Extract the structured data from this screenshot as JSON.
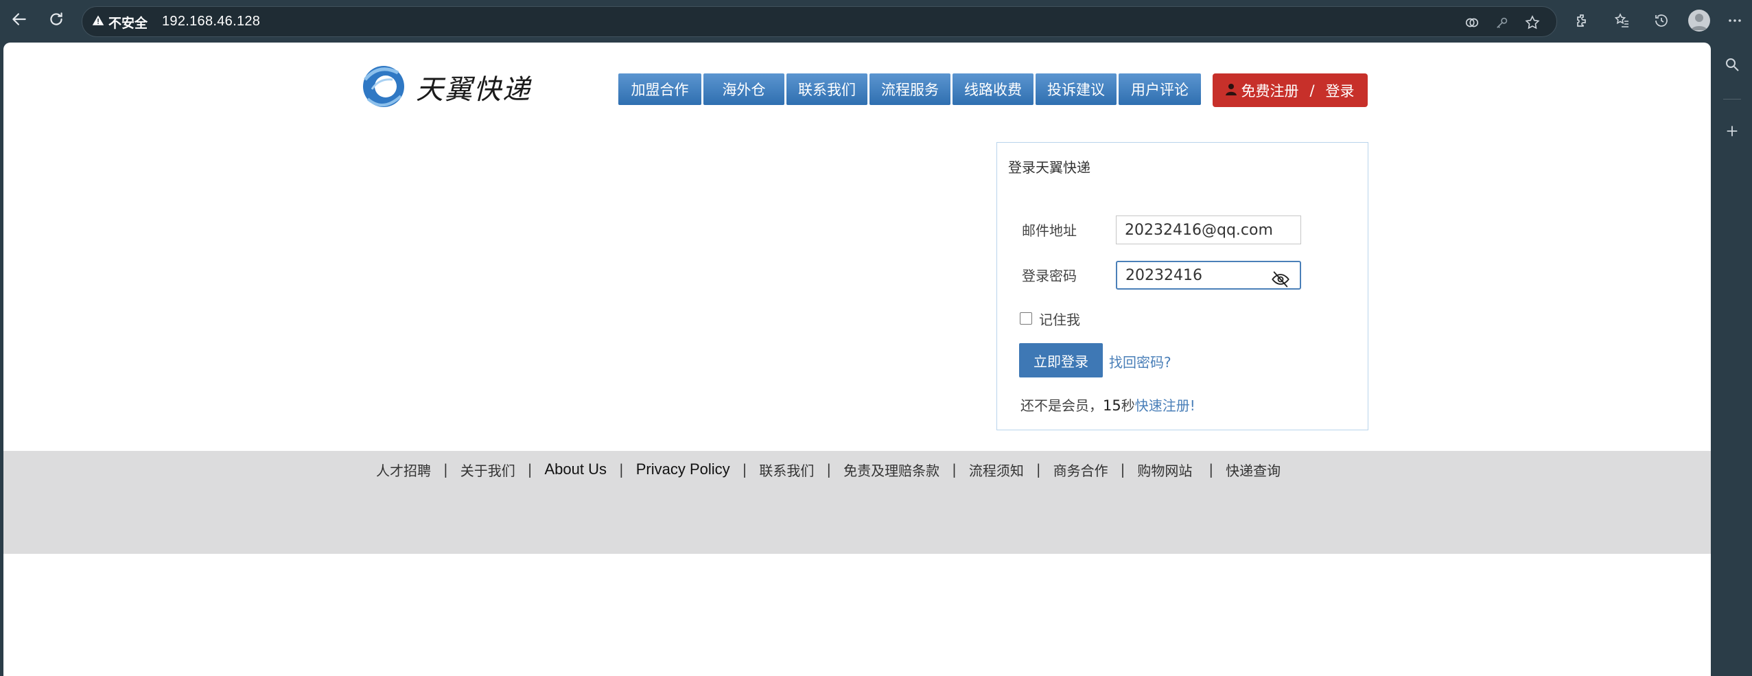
{
  "browser": {
    "security_label": "不安全",
    "url": "192.168.46.128"
  },
  "site": {
    "logo_text": "天翼快递",
    "nav": [
      "加盟合作",
      "海外仓",
      "联系我们",
      "流程服务",
      "线路收费",
      "投诉建议",
      "用户评论"
    ],
    "register_label": "免费注册",
    "separator": "/",
    "login_label": "登录"
  },
  "login": {
    "title": "登录天翼快递",
    "email_label": "邮件地址",
    "email_value": "20232416@qq.com",
    "password_label": "登录密码",
    "password_value": "20232416",
    "remember_label": "记住我",
    "submit_label": "立即登录",
    "forgot_label": "找回密码?",
    "member_prefix": "还不是会员，",
    "member_number": "15",
    "member_unit": "秒",
    "member_link": "快速注册",
    "member_suffix": "!"
  },
  "footer": {
    "links": [
      "人才招聘",
      "关于我们",
      "About Us",
      "Privacy Policy",
      "联系我们",
      "免责及理赔条款",
      "流程须知",
      "商务合作",
      "购物网站",
      "快递查询"
    ],
    "separator": "|"
  },
  "icons": {
    "back": "arrow-left-icon",
    "reload": "reload-icon",
    "warning": "warning-icon",
    "eye_off": "eye-off-icon"
  }
}
